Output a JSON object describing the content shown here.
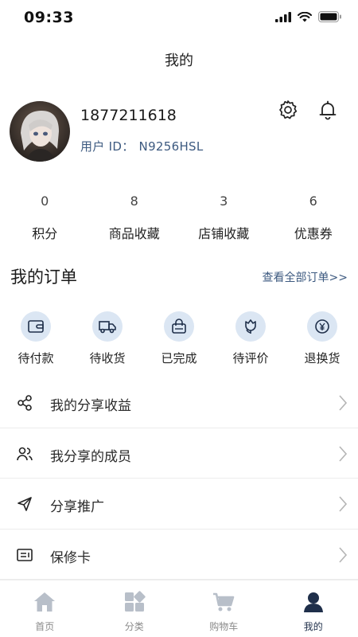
{
  "status": {
    "time": "09:33"
  },
  "nav": {
    "title": "我的"
  },
  "profile": {
    "phone": "1877211618",
    "id_label": "用户 ID：",
    "id_value": "N9256HSL"
  },
  "stats": [
    {
      "value": "0",
      "label": "积分"
    },
    {
      "value": "8",
      "label": "商品收藏"
    },
    {
      "value": "3",
      "label": "店铺收藏"
    },
    {
      "value": "6",
      "label": "优惠券"
    }
  ],
  "orders": {
    "title": "我的订单",
    "view_all": "查看全部订单>>",
    "items": [
      {
        "label": "待付款",
        "icon": "wallet-icon"
      },
      {
        "label": "待收货",
        "icon": "truck-icon"
      },
      {
        "label": "已完成",
        "icon": "bag-icon"
      },
      {
        "label": "待评价",
        "icon": "flower-icon"
      },
      {
        "label": "退换货",
        "icon": "yen-icon"
      }
    ]
  },
  "menu": [
    {
      "label": "我的分享收益",
      "icon": "share-icon"
    },
    {
      "label": "我分享的成员",
      "icon": "members-icon"
    },
    {
      "label": "分享推广",
      "icon": "send-icon"
    },
    {
      "label": "保修卡",
      "icon": "card-icon"
    }
  ],
  "tabs": [
    {
      "label": "首页",
      "icon": "home-icon"
    },
    {
      "label": "分类",
      "icon": "category-icon"
    },
    {
      "label": "购物车",
      "icon": "cart-icon"
    },
    {
      "label": "我的",
      "icon": "user-icon",
      "active": true
    }
  ],
  "colors": {
    "accent": "#3d5a80",
    "icon_bg": "#dbe6f3",
    "tab_inactive": "#b8bfc9",
    "tab_active": "#1f2f4a"
  }
}
